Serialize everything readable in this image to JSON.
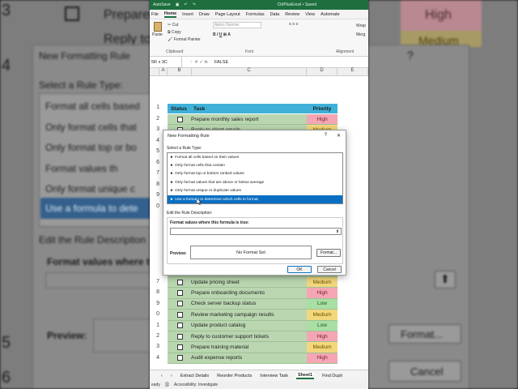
{
  "background_left": {
    "items": [
      "Prepare",
      "Reply to",
      "New Formatting Rule",
      "Select a Rule Type:",
      "Format all cells based",
      "Only format cells that",
      "Only format top or bo",
      "Format values th",
      "Only format unique c",
      "Use a formula to dete",
      "Edit the Rule Description",
      "Format values where th",
      "Preview:"
    ],
    "row_numbers": [
      "3",
      "4",
      "5",
      "6"
    ]
  },
  "background_right": {
    "items": [
      "High",
      "Medium",
      "?",
      "Format...",
      "Cancel"
    ]
  },
  "excel": {
    "title": {
      "autosave": "AutoSave",
      "file": "CtrlPlusExcel • Saved"
    },
    "ribbon_tabs": [
      "File",
      "Home",
      "Insert",
      "Draw",
      "Page Layout",
      "Formulas",
      "Data",
      "Review",
      "View",
      "Automate"
    ],
    "active_tab": "Home",
    "ribbon": {
      "paste": "Paste",
      "cut": "Cut",
      "copy": "Copy",
      "format_painter": "Format Painter",
      "clipboard": "Clipboard",
      "font_name": "Aptos Narrow",
      "font": "Font",
      "wrap": "Wrap",
      "merge": "Merg",
      "alignment": "Alignment"
    },
    "namebox": "5R x 3C",
    "fx": "fx",
    "formula_value": "FALSE",
    "columns": [
      "A",
      "B",
      "C",
      "D",
      "E"
    ],
    "header": {
      "status": "Status",
      "task": "Task",
      "priority": "Priority"
    },
    "row_numbers_top": [
      "1",
      "2",
      "3",
      "4",
      "5",
      "6",
      "7",
      "8",
      "9",
      "0"
    ],
    "row_numbers_bottom": [
      "7",
      "8",
      "9",
      "0",
      "1",
      "2",
      "3",
      "4"
    ],
    "top_rows": [
      {
        "task": "Prepare monthly sales report",
        "priority": "High"
      },
      {
        "task": "Reply to client emails",
        "priority": "Medium"
      }
    ],
    "bottom_rows": [
      {
        "task": "Update pricing sheet",
        "priority": "Medium"
      },
      {
        "task": "Prepare onboarding documents",
        "priority": "High"
      },
      {
        "task": "Check server backup status",
        "priority": "Low"
      },
      {
        "task": "Review marketing campaign results",
        "priority": "Medium"
      },
      {
        "task": "Update product catalog",
        "priority": "Low"
      },
      {
        "task": "Reply to customer support tickets",
        "priority": "High"
      },
      {
        "task": "Prepare training material",
        "priority": "Medium"
      },
      {
        "task": "Audit expense reports",
        "priority": "High"
      }
    ],
    "sheet_tabs": [
      "Extract Details",
      "Reorder Products",
      "Interview Task",
      "Sheet1",
      "Find Dupli"
    ],
    "active_sheet": "Sheet1",
    "status": {
      "ready": "eady",
      "accessibility": "Accessibility: Investigate"
    }
  },
  "dialog": {
    "title": "New Formatting Rule",
    "help": "?",
    "close": "✕",
    "select_label": "Select a Rule Type:",
    "rule_types": [
      "► Format all cells based on their values",
      "► Only format cells that contain",
      "► Only format top or bottom ranked values",
      "► Only format values that are above or below average",
      "► Only format unique or duplicate values",
      "► Use a formula to determine which cells to format"
    ],
    "selected_index": 5,
    "edit_label": "Edit the Rule Description:",
    "formula_label": "Format values where this formula is true:",
    "formula_value": "",
    "preview_label": "Preview:",
    "preview_text": "No Format Set",
    "format_button": "Format...",
    "ok_button": "OK",
    "cancel_button": "Cancel"
  },
  "colors": {
    "excel_green": "#1e6e3e",
    "header_blue": "#3fb1d8",
    "row_green": "#b9d6b0",
    "high": "#f4a6b4",
    "medium": "#f3d77c",
    "low": "#a9dfa4",
    "selected": "#0a6fc2"
  }
}
